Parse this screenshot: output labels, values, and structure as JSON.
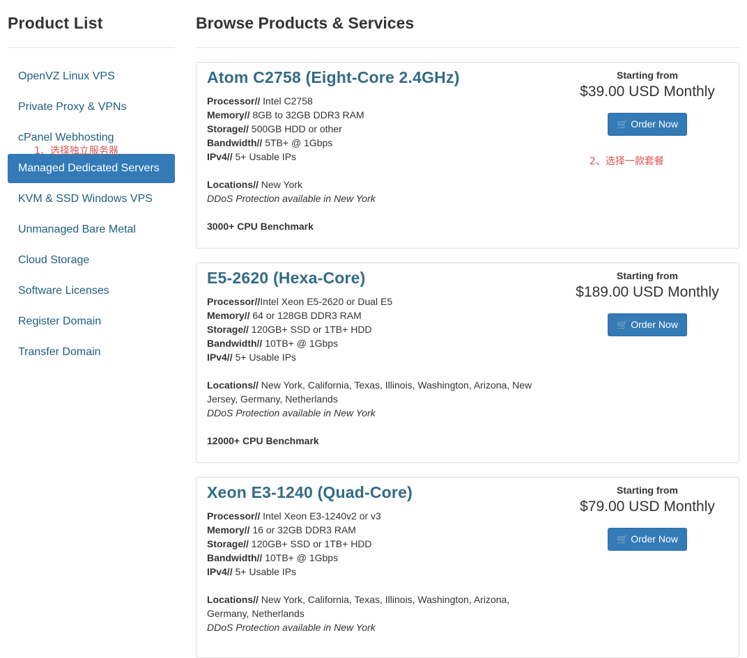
{
  "sidebar": {
    "title": "Product List",
    "items": [
      {
        "label": "OpenVZ Linux VPS"
      },
      {
        "label": "Private Proxy & VPNs"
      },
      {
        "label": "cPanel Webhosting"
      },
      {
        "label": "Managed Dedicated Servers"
      },
      {
        "label": "KVM & SSD Windows VPS"
      },
      {
        "label": "Unmanaged Bare Metal"
      },
      {
        "label": "Cloud Storage"
      },
      {
        "label": "Software Licenses"
      },
      {
        "label": "Register Domain"
      },
      {
        "label": "Transfer Domain"
      }
    ],
    "active_index": 3
  },
  "annotations": {
    "step1": "1、选择独立服务器",
    "step2": "2、选择一款套餐",
    "color": "#d9534f"
  },
  "main": {
    "title": "Browse Products & Services",
    "starting_from": "Starting from",
    "order_label": "Order Now",
    "products": [
      {
        "name": "Atom C2758 (Eight-Core 2.4GHz)",
        "processor": " Intel C2758",
        "memory": " 8GB to 32GB DDR3 RAM",
        "storage": " 500GB HDD or other",
        "bandwidth": " 5TB+ @ 1Gbps",
        "ipv4": " 5+ Usable IPs",
        "locations": " New York",
        "ddos": "DDoS Protection available in New York",
        "benchmark": "3000+ CPU Benchmark",
        "price": "$39.00 USD Monthly"
      },
      {
        "name": "E5-2620 (Hexa-Core)",
        "processor": "Intel Xeon E5-2620 or Dual E5",
        "memory": " 64 or 128GB DDR3 RAM",
        "storage": " 120GB+ SSD or 1TB+ HDD",
        "bandwidth": " 10TB+ @ 1Gbps",
        "ipv4": " 5+ Usable IPs",
        "locations": " New York, California, Texas, Illinois, Washington, Arizona, New Jersey, Germany, Netherlands",
        "ddos": "DDoS Protection available in New York",
        "benchmark": "12000+ CPU Benchmark",
        "price": "$189.00 USD Monthly"
      },
      {
        "name": "Xeon E3-1240 (Quad-Core)",
        "processor": " Intel Xeon E3-1240v2 or v3",
        "memory": " 16 or 32GB DDR3 RAM",
        "storage": " 120GB+ SSD or 1TB+ HDD",
        "bandwidth": " 10TB+ @ 1Gbps",
        "ipv4": " 5+ Usable IPs",
        "locations": " New York, California, Texas, Illinois, Washington, Arizona, Germany, Netherlands",
        "ddos": "DDoS Protection available in New York",
        "benchmark": "",
        "price": "$79.00 USD Monthly"
      }
    ],
    "spec_labels": {
      "processor": "Processor//",
      "memory": "Memory//",
      "storage": "Storage//",
      "bandwidth": "Bandwidth//",
      "ipv4": "IPv4//",
      "locations": "Locations//"
    }
  },
  "colors": {
    "accent": "#337ab7",
    "link": "#1f5e82",
    "product_title": "#336b87"
  },
  "icons": {
    "order_button": "shopping-cart-icon"
  }
}
